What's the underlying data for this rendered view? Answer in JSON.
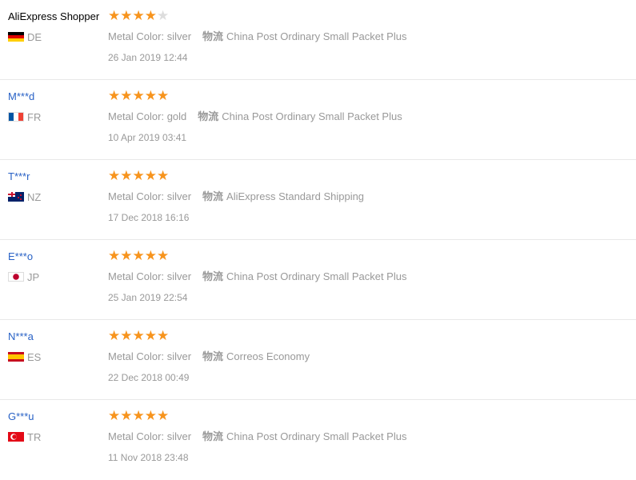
{
  "colors": {
    "star_on": "#f7941d",
    "star_off": "#dddddd",
    "username": "#2962c6",
    "meta": "#999999"
  },
  "reviews": [
    {
      "user": "AliExpress Shopper",
      "country": "DE",
      "flag": "germany-flag-icon",
      "rating": 4,
      "metal_color": "Metal Color: silver",
      "logistics_label": "物流",
      "shipping": "China Post Ordinary Small Packet Plus",
      "date": "26 Jan 2019 12:44"
    },
    {
      "user": "M***d",
      "country": "FR",
      "flag": "france-flag-icon",
      "rating": 5,
      "metal_color": "Metal Color: gold",
      "logistics_label": "物流",
      "shipping": "China Post Ordinary Small Packet Plus",
      "date": "10 Apr 2019 03:41"
    },
    {
      "user": "T***r",
      "country": "NZ",
      "flag": "new-zealand-flag-icon",
      "rating": 5,
      "metal_color": "Metal Color: silver",
      "logistics_label": "物流",
      "shipping": "AliExpress Standard Shipping",
      "date": "17 Dec 2018 16:16"
    },
    {
      "user": "E***o",
      "country": "JP",
      "flag": "japan-flag-icon",
      "rating": 5,
      "metal_color": "Metal Color: silver",
      "logistics_label": "物流",
      "shipping": "China Post Ordinary Small Packet Plus",
      "date": "25 Jan 2019 22:54"
    },
    {
      "user": "N***a",
      "country": "ES",
      "flag": "spain-flag-icon",
      "rating": 5,
      "metal_color": "Metal Color: silver",
      "logistics_label": "物流",
      "shipping": "Correos Economy",
      "date": "22 Dec 2018 00:49"
    },
    {
      "user": "G***u",
      "country": "TR",
      "flag": "turkey-flag-icon",
      "rating": 5,
      "metal_color": "Metal Color: silver",
      "logistics_label": "物流",
      "shipping": "China Post Ordinary Small Packet Plus",
      "date": "11 Nov 2018 23:48"
    }
  ]
}
